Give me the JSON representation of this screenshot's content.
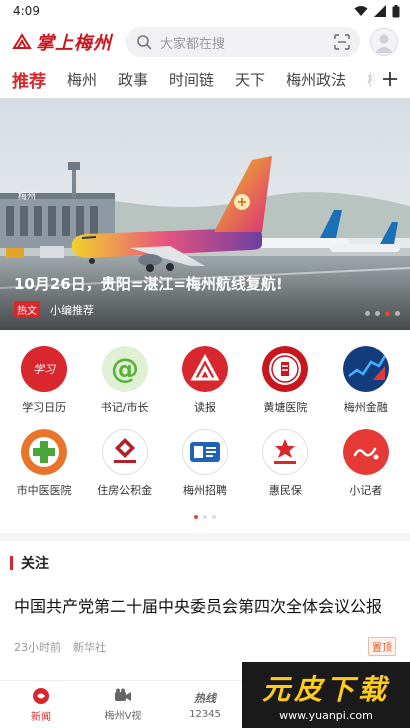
{
  "status": {
    "time": "4:09"
  },
  "header": {
    "logo_text": "掌上梅州",
    "search_placeholder": "大家都在搜"
  },
  "tabs": [
    {
      "label": "推荐",
      "active": true
    },
    {
      "label": "梅州"
    },
    {
      "label": "政事"
    },
    {
      "label": "时间链"
    },
    {
      "label": "天下"
    },
    {
      "label": "梅州政法"
    },
    {
      "label": "梅"
    }
  ],
  "banner": {
    "title": "10月26日，贵阳=湛江=梅州航线复航!",
    "tag": "热文",
    "source": "小编推荐",
    "airport_sign": "梅州"
  },
  "shortcuts": [
    {
      "label": "学习日历",
      "icon": "xuexi-calendar-icon",
      "color": "#d8282d"
    },
    {
      "label": "书记/市长",
      "icon": "at-sign-icon",
      "color": "#5ab13a"
    },
    {
      "label": "读报",
      "icon": "newspaper-icon",
      "color": "#d8282d"
    },
    {
      "label": "黄塘医院",
      "icon": "hospital-seal-icon",
      "color": "#c8161d"
    },
    {
      "label": "梅州金融",
      "icon": "finance-chart-icon",
      "color": "#1a4fa0"
    },
    {
      "label": "市中医医院",
      "icon": "medical-cross-icon",
      "color": "#e8752b"
    },
    {
      "label": "住房公积金",
      "icon": "housing-fund-icon",
      "color": "#b02028"
    },
    {
      "label": "梅州招聘",
      "icon": "recruit-icon",
      "color": "#1e63b8"
    },
    {
      "label": "惠民保",
      "icon": "huiminbao-icon",
      "color": "#d8282d"
    },
    {
      "label": "小记者",
      "icon": "reporter-icon",
      "color": "#e53935"
    }
  ],
  "follow": {
    "section_title": "关注",
    "news_title": "中国共产党第二十届中央委员会第四次全体会议公报",
    "time": "23小时前",
    "source": "新华社",
    "pin": "置顶"
  },
  "bottom_nav": [
    {
      "label": "新闻",
      "icon": "news-globe-icon",
      "active": true
    },
    {
      "label": "梅州V视",
      "icon": "video-camera-icon"
    },
    {
      "label": "12345",
      "icon": "hotline-icon",
      "glyph": "热线"
    }
  ],
  "watermark": {
    "title": "元皮下载",
    "url": "www.yuanpi.com"
  },
  "colors": {
    "brand": "#d8282d",
    "accent": "#e8452f"
  }
}
